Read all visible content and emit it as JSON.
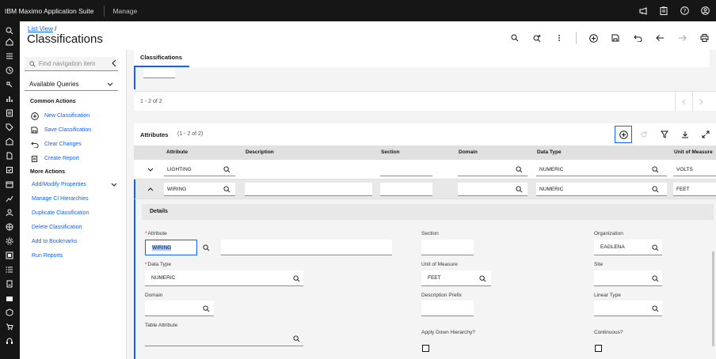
{
  "topbar": {
    "brand": "IBM Maximo Application Suite",
    "app": "Manage",
    "icons": [
      "megaphone-icon",
      "clipboard-icon",
      "help-icon",
      "user-icon"
    ]
  },
  "header": {
    "breadcrumb": "List View",
    "breadcrumb_sep": "/",
    "title": "Classifications",
    "icons": [
      "search-icon",
      "search-advanced-icon",
      "overflow-menu-icon",
      "add-icon",
      "save-icon",
      "undo-icon",
      "previous-icon",
      "next-icon",
      "print-icon"
    ]
  },
  "sidebar": {
    "search_placeholder": "Find navigation item",
    "queries_label": "Available Queries",
    "common_actions_title": "Common Actions",
    "common_actions": [
      {
        "label": "New Classification",
        "icon": "add-icon"
      },
      {
        "label": "Save Classification",
        "icon": "save-icon"
      },
      {
        "label": "Clear Changes",
        "icon": "undo-icon"
      },
      {
        "label": "Create Report",
        "icon": "report-icon"
      }
    ],
    "more_actions_title": "More Actions",
    "more_actions": [
      {
        "label": "Add/Modify Properties"
      },
      {
        "label": "Manage CI Hierarchies"
      },
      {
        "label": "Duplicate Classification"
      },
      {
        "label": "Delete Classification"
      },
      {
        "label": "Add to Bookmarks"
      },
      {
        "label": "Run Reports"
      }
    ]
  },
  "tabs": [
    {
      "label": "Classifications"
    }
  ],
  "pager": {
    "count": "1 - 2 of 2"
  },
  "attributes": {
    "title": "Attributes",
    "count": "(1 - 2 of 2)",
    "columns": [
      "Attribute",
      "Description",
      "Section",
      "Domain",
      "Data Type",
      "Unit of Measure"
    ],
    "rows": [
      {
        "attribute": "LIGHTING",
        "description": "",
        "section": "",
        "domain": "",
        "data_type": "NUMERIC",
        "uom": "VOLTS"
      },
      {
        "attribute": "WIRING",
        "description": "",
        "section": "",
        "domain": "",
        "data_type": "NUMERIC",
        "uom": "FEET"
      }
    ]
  },
  "details": {
    "title": "Details",
    "attribute_label": "Attribute",
    "attribute_value": "WIRING",
    "data_type_label": "Data Type",
    "data_type_value": "NUMERIC",
    "domain_label": "Domain",
    "table_attribute_label": "Table Attribute",
    "section_label": "Section",
    "uom_label": "Unit of Measure",
    "uom_value": "FEET",
    "desc_prefix_label": "Description Prefix",
    "apply_down_label": "Apply Down Hierarchy?",
    "organization_label": "Organization",
    "organization_value": "EAGLENA",
    "site_label": "Site",
    "linear_type_label": "Linear Type",
    "continuous_label": "Continuous?"
  }
}
